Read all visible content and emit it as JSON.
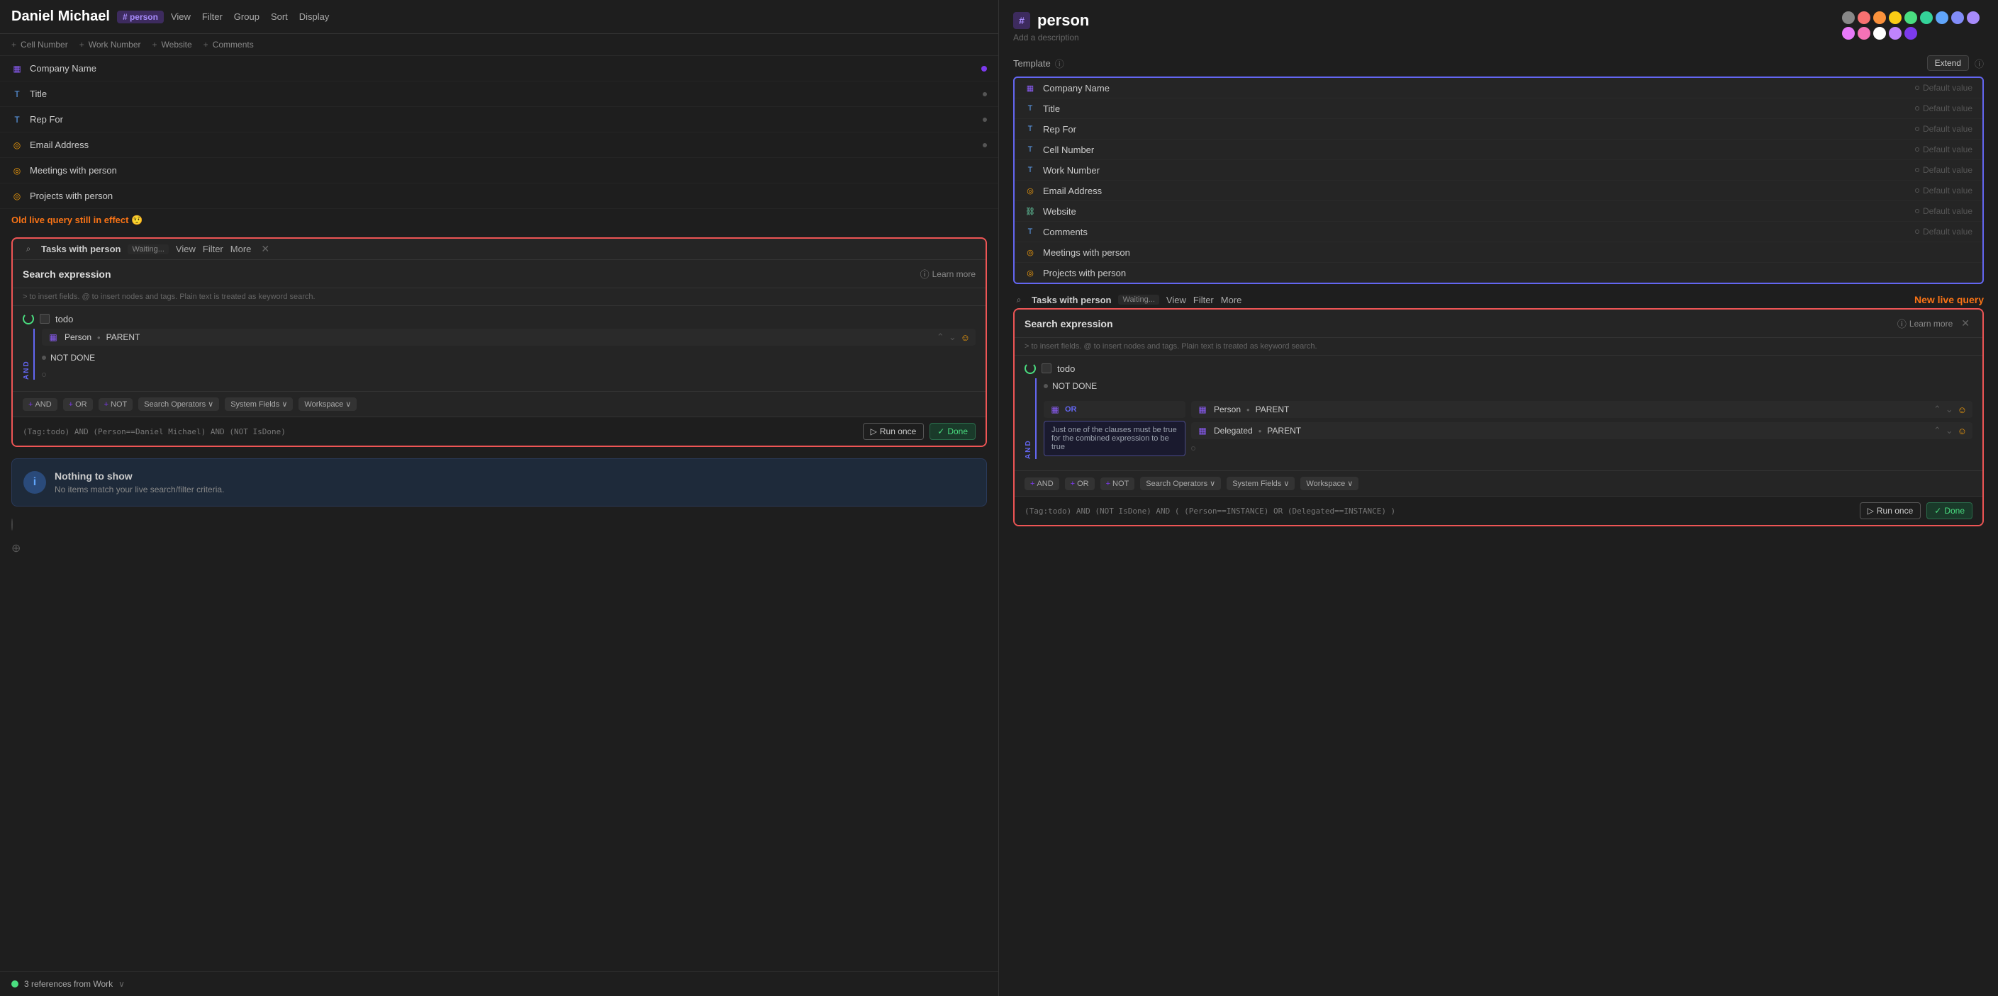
{
  "left": {
    "title": "Daniel Michael",
    "tag": "# person",
    "nav": [
      "View",
      "Filter",
      "Group",
      "Sort",
      "Display"
    ],
    "toolbar": [
      {
        "label": "Cell Number",
        "prefix": "+"
      },
      {
        "label": "Work Number",
        "prefix": "+"
      },
      {
        "label": "Website",
        "prefix": "+"
      },
      {
        "label": "Comments",
        "prefix": "+"
      }
    ],
    "fields": [
      {
        "icon": "grid",
        "name": "Company Name",
        "hasDot": true,
        "dotColor": "#7c3aed"
      },
      {
        "icon": "text",
        "name": "Title",
        "hasDot": true,
        "dotColor": "#555"
      },
      {
        "icon": "text",
        "name": "Rep For",
        "hasDot": true,
        "dotColor": "#555"
      },
      {
        "icon": "circle",
        "name": "Email Address",
        "hasDot": true,
        "dotColor": "#555"
      },
      {
        "icon": "circle",
        "name": "Meetings with person",
        "hasDot": false
      },
      {
        "icon": "circle",
        "name": "Projects with person",
        "hasDot": false
      }
    ],
    "oldQuery": {
      "notice": "Old live query still in effect 🤨",
      "tasksHeader": "Tasks with person",
      "waiting": "Waiting...",
      "navItems": [
        "View",
        "Filter",
        "More"
      ],
      "searchBox": {
        "title": "Search expression",
        "learnMore": "Learn more",
        "hint": "> to insert fields.  @ to insert nodes and tags. Plain text is treated as keyword search.",
        "tag": "todo",
        "conditions": [
          {
            "field": "Person",
            "bullet": "•",
            "value": "PARENT"
          },
          {
            "notDone": "NOT DONE"
          }
        ],
        "toolbar": [
          {
            "label": "AND",
            "prefix": "+"
          },
          {
            "label": "OR",
            "prefix": "+"
          },
          {
            "label": "NOT",
            "prefix": "+"
          },
          {
            "label": "Search Operators",
            "hasChevron": true
          },
          {
            "label": "System Fields",
            "hasChevron": true
          },
          {
            "label": "Workspace",
            "hasChevron": true
          }
        ],
        "queryText": "(Tag:todo) AND (Person==Daniel Michael) AND (NOT IsDone)",
        "runOnce": "Run once",
        "done": "Done"
      }
    },
    "nothingBox": {
      "title": "Nothing to show",
      "desc": "No items match your live search/filter criteria."
    },
    "refs": "3 references from Work"
  },
  "right": {
    "title": "person",
    "desc": "Add a description",
    "colors": [
      "#888",
      "#f87171",
      "#fb923c",
      "#facc15",
      "#4ade80",
      "#34d399",
      "#60a5fa",
      "#818cf8",
      "#a78bfa",
      "#e879f9",
      "#f472b6",
      "#fff"
    ],
    "template": {
      "label": "Template",
      "extendBtn": "Extend",
      "fields": [
        {
          "icon": "grid",
          "name": "Company Name",
          "default": "Default value"
        },
        {
          "icon": "text",
          "name": "Title",
          "default": "Default value"
        },
        {
          "icon": "text",
          "name": "Rep For",
          "default": "Default value"
        },
        {
          "icon": "text",
          "name": "Cell Number",
          "default": "Default value"
        },
        {
          "icon": "text",
          "name": "Work Number",
          "default": "Default value"
        },
        {
          "icon": "circle",
          "name": "Email Address",
          "default": "Default value"
        },
        {
          "icon": "link",
          "name": "Website",
          "default": "Default value"
        },
        {
          "icon": "text",
          "name": "Comments",
          "default": "Default value"
        },
        {
          "icon": "circle",
          "name": "Meetings with person",
          "default": ""
        },
        {
          "icon": "circle",
          "name": "Projects with person",
          "default": ""
        }
      ]
    },
    "newQuery": {
      "notice": "New live query",
      "tasksHeader": "Tasks with person",
      "waiting": "Waiting...",
      "navItems": [
        "View",
        "Filter",
        "More"
      ],
      "searchBox": {
        "title": "Search expression",
        "learnMore": "Learn more",
        "hint": "> to insert fields.  @ to insert nodes and tags. Plain text is treated as keyword search.",
        "tag": "todo",
        "notDone": "NOT DONE",
        "orLabel": "OR",
        "orTooltip": "Just one of the clauses must be true for the combined expression to be true",
        "conditions": [
          {
            "field": "Person",
            "value": "PARENT"
          },
          {
            "field": "Delegated",
            "value": "PARENT"
          }
        ],
        "toolbar": [
          {
            "label": "AND",
            "prefix": "+"
          },
          {
            "label": "OR",
            "prefix": "+"
          },
          {
            "label": "NOT",
            "prefix": "+"
          },
          {
            "label": "Search Operators",
            "hasChevron": true
          },
          {
            "label": "System Fields",
            "hasChevron": true
          },
          {
            "label": "Workspace",
            "hasChevron": true
          }
        ],
        "queryText": "(Tag:todo) AND (NOT IsDone) AND ( (Person==INSTANCE) OR (Delegated==INSTANCE) )",
        "runOnce": "Run once",
        "done": "Done"
      }
    }
  }
}
